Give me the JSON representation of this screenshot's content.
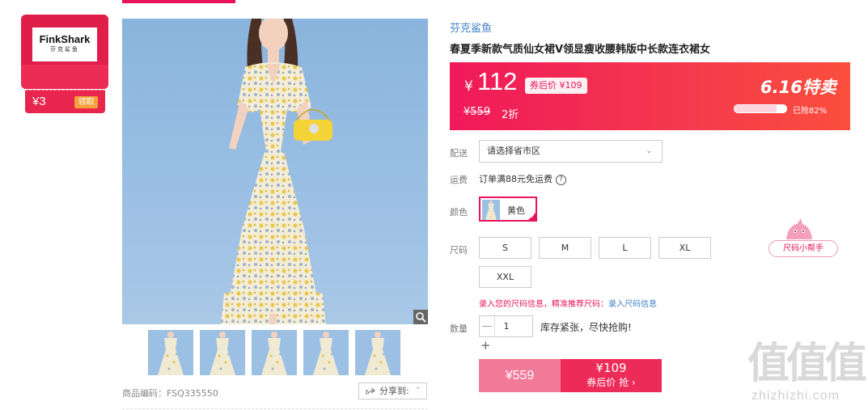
{
  "store": {
    "logo_en": "FinkShark",
    "logo_cn": "芬克鲨鱼",
    "coupon_value": "¥3",
    "coupon_button": "领取"
  },
  "gallery": {
    "sku": "商品编码：FSQ335550",
    "share_label": "分享到:",
    "share_caret": "˅",
    "thumbnail_count": 5
  },
  "product": {
    "brand": "芬克鲨鱼",
    "title": "春夏季新款气质仙女裙V领显瘦收腰韩版中长款连衣裙女"
  },
  "price_panel": {
    "currency": "¥",
    "price": "112",
    "coupon_price": "券后价 ¥109",
    "original_price": "¥559",
    "discount": "2折",
    "promo": "6.16特卖",
    "sold_percent": 82,
    "sold_text": "已抢82%"
  },
  "delivery": {
    "label": "配送",
    "placeholder": "请选择省市区",
    "caret": "⌄"
  },
  "shipping": {
    "label": "运费",
    "text": "订单满88元免运费",
    "help_glyph": "?"
  },
  "color": {
    "label": "颜色",
    "selected": "黄色",
    "check": "✓"
  },
  "size": {
    "label": "尺码",
    "options": [
      "S",
      "M",
      "L",
      "XL",
      "XXL"
    ],
    "tip": "录入您的尺码信息，精准推荐尺码：",
    "tip_link": "录入尺码信息",
    "helper": "尺码小帮手"
  },
  "quantity": {
    "label": "数量",
    "value": "1",
    "minus": "—",
    "plus": "+",
    "stock_note": "库存紧张，尽快抢购!"
  },
  "buy": {
    "original_price": "¥559",
    "coupon_price": "¥109",
    "coupon_label": "券后价 抢 ›"
  },
  "watermark": {
    "logo": "值值值",
    "text": "zhizhizhi.com"
  },
  "colors": {
    "accent": "#e8135c",
    "link": "#3d7fc7",
    "price_panel_start": "#f0195a",
    "price_panel_end": "#fb4e3c"
  }
}
